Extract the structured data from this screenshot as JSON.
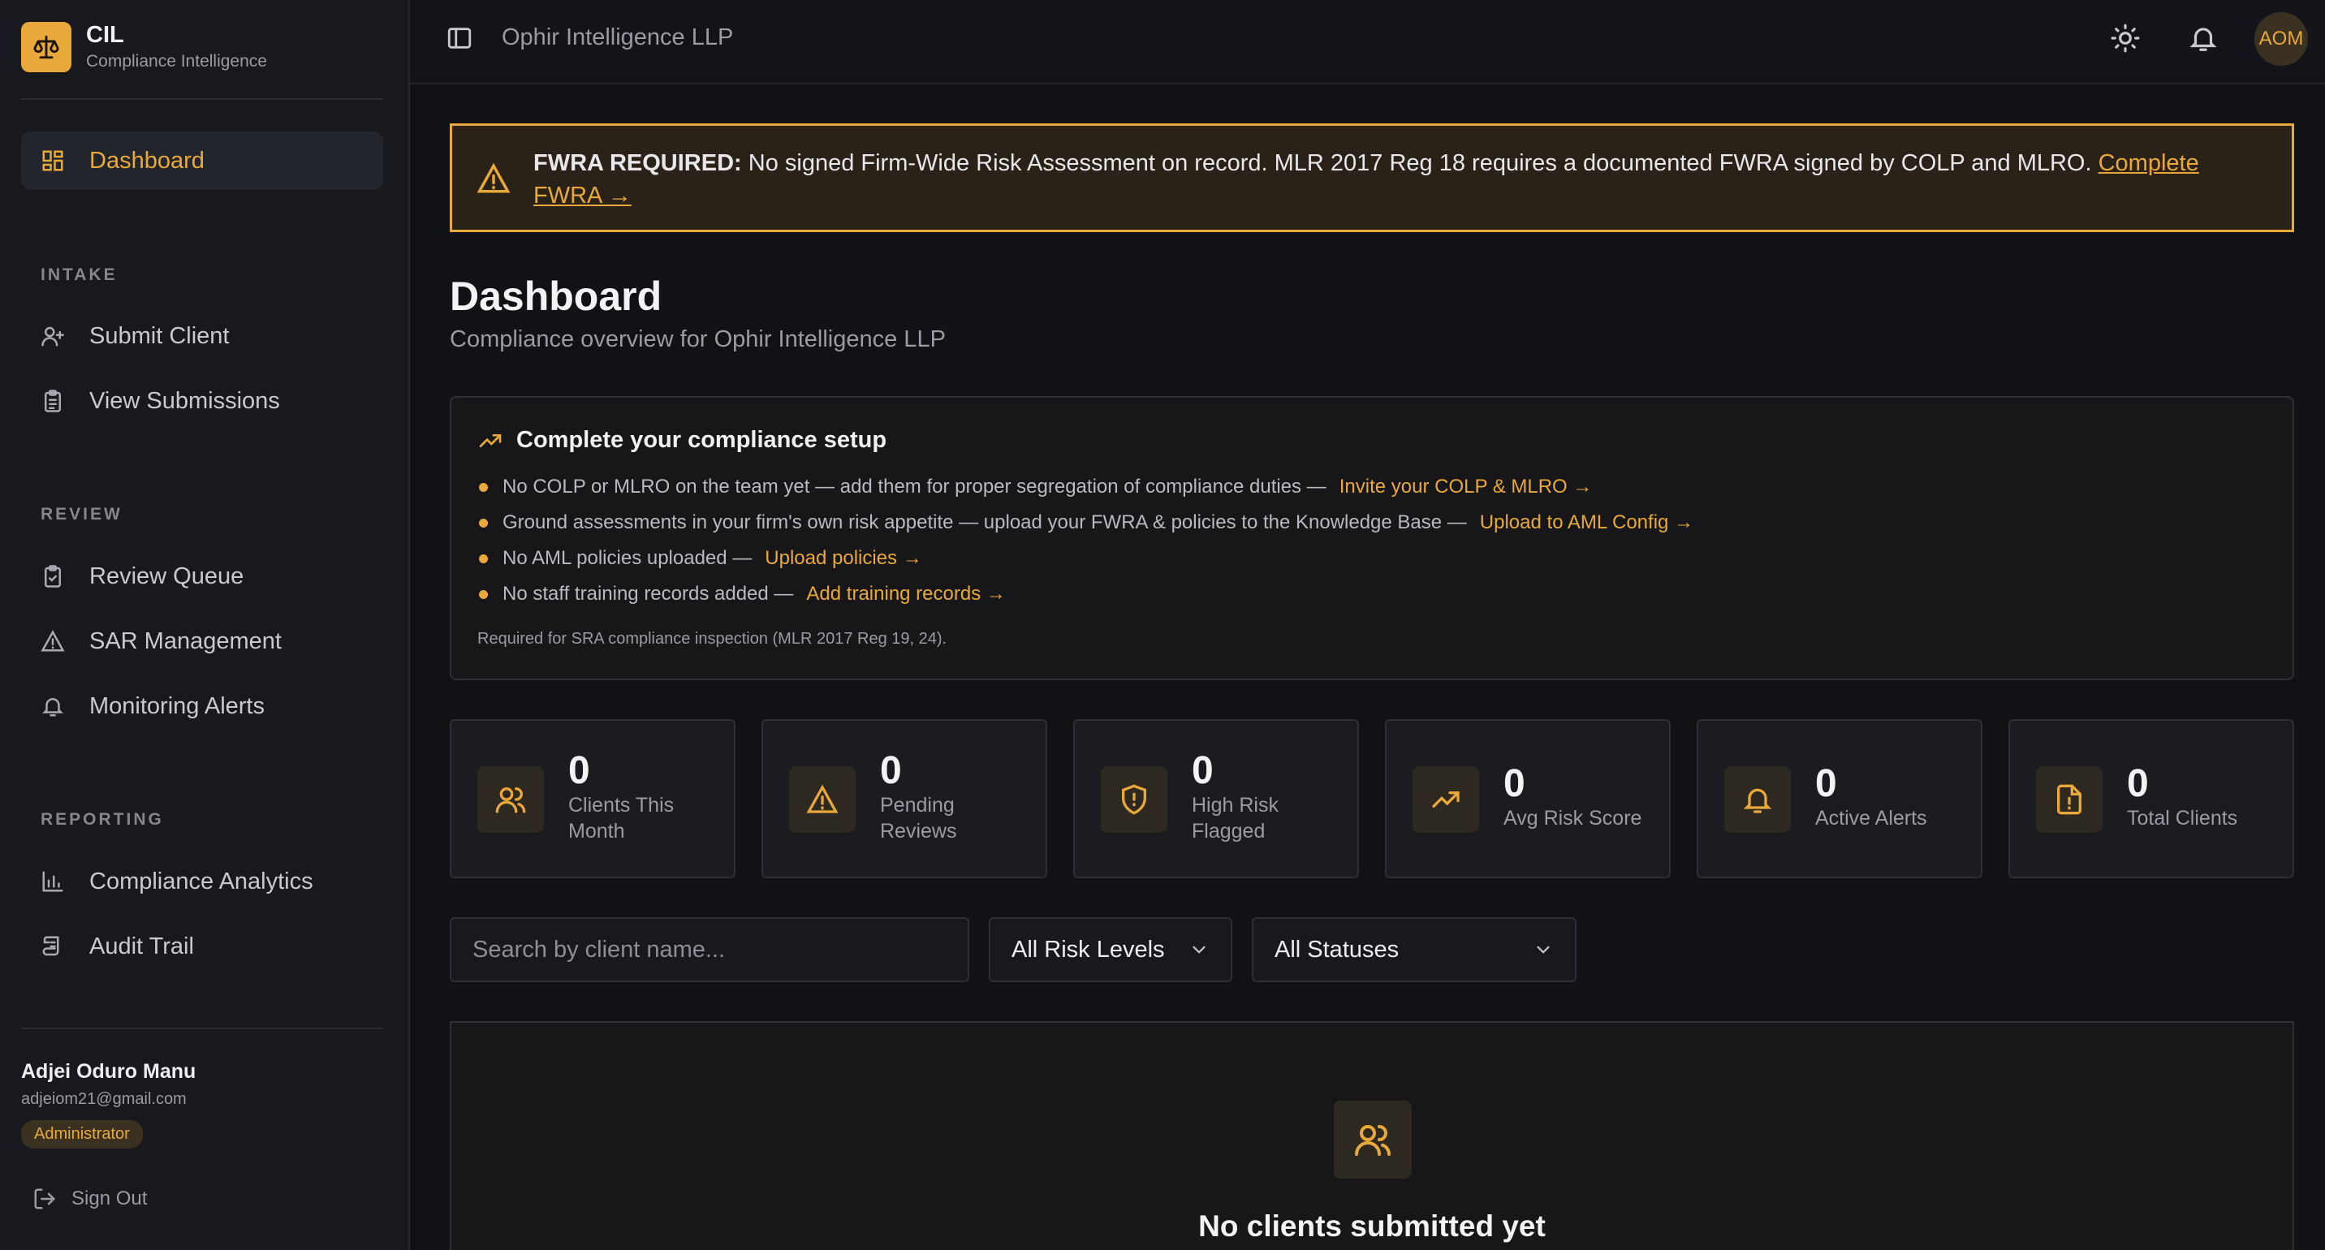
{
  "brand": {
    "title": "CIL",
    "subtitle": "Compliance Intelligence"
  },
  "sidebar": {
    "dashboard": "Dashboard",
    "sections": {
      "intake": "INTAKE",
      "review": "REVIEW",
      "reporting": "REPORTING"
    },
    "items": {
      "submit_client": "Submit Client",
      "view_submissions": "View Submissions",
      "review_queue": "Review Queue",
      "sar_management": "SAR Management",
      "monitoring_alerts": "Monitoring Alerts",
      "compliance_analytics": "Compliance Analytics",
      "audit_trail": "Audit Trail"
    },
    "user": {
      "name": "Adjei Oduro Manu",
      "email": "adjeiom21@gmail.com",
      "role": "Administrator"
    },
    "sign_out": "Sign Out"
  },
  "topbar": {
    "org_name": "Ophir Intelligence LLP",
    "avatar_initials": "AOM"
  },
  "banner": {
    "bold": "FWRA REQUIRED:",
    "text": " No signed Firm-Wide Risk Assessment on record. MLR 2017 Reg 18 requires a documented FWRA signed by COLP and MLRO. ",
    "link": "Complete FWRA →"
  },
  "page": {
    "title": "Dashboard",
    "subtitle": "Compliance overview for Ophir Intelligence LLP"
  },
  "setup": {
    "title": "Complete your compliance setup",
    "items": [
      {
        "text": "No COLP or MLRO on the team yet — add them for proper segregation of compliance duties —",
        "link": "Invite your COLP & MLRO →"
      },
      {
        "text": "Ground assessments in your firm's own risk appetite — upload your FWRA & policies to the Knowledge Base —",
        "link": "Upload to AML Config →"
      },
      {
        "text": "No AML policies uploaded —",
        "link": "Upload policies →"
      },
      {
        "text": "No staff training records added —",
        "link": "Add training records →"
      }
    ],
    "note": "Required for SRA compliance inspection (MLR 2017 Reg 19, 24)."
  },
  "stats": [
    {
      "value": "0",
      "label": "Clients This Month",
      "icon": "users-icon"
    },
    {
      "value": "0",
      "label": "Pending Reviews",
      "icon": "warning-icon"
    },
    {
      "value": "0",
      "label": "High Risk Flagged",
      "icon": "shield-alert-icon"
    },
    {
      "value": "0",
      "label": "Avg Risk Score",
      "icon": "trending-up-icon"
    },
    {
      "value": "0",
      "label": "Active Alerts",
      "icon": "bell-icon"
    },
    {
      "value": "0",
      "label": "Total Clients",
      "icon": "file-alert-icon"
    }
  ],
  "filters": {
    "search_placeholder": "Search by client name...",
    "risk_level": "All Risk Levels",
    "status": "All Statuses"
  },
  "empty": {
    "title": "No clients submitted yet"
  },
  "colors": {
    "accent": "#e9a93a",
    "background": "#111216",
    "sidebar": "#18191e"
  }
}
